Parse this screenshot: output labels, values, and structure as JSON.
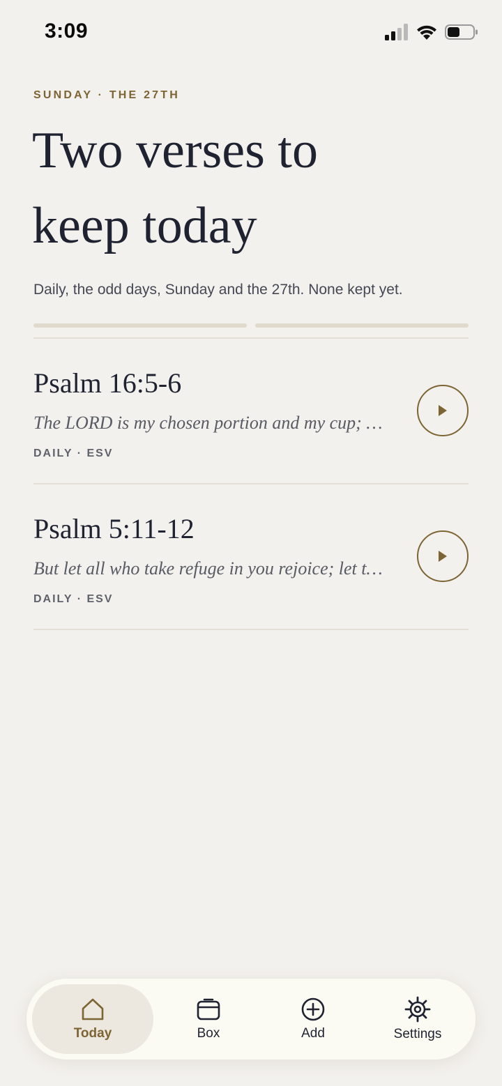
{
  "status_bar": {
    "time": "3:09",
    "icons": [
      "cellular-signal-icon",
      "wifi-icon",
      "battery-icon"
    ]
  },
  "header": {
    "eyebrow": "SUNDAY · THE 27TH",
    "headline_line1": "Two verses to",
    "headline_line2": "keep today",
    "subtitle": "Daily, the odd days, Sunday and the 27th. None kept yet."
  },
  "progress": {
    "segments": 2,
    "kept": 0
  },
  "verses": [
    {
      "reference": "Psalm 16:5-6",
      "excerpt": "The LORD is my chosen portion and my cup; yo...",
      "meta": "DAILY · ESV"
    },
    {
      "reference": "Psalm 5:11-12",
      "excerpt": "But let all who take refuge in you rejoice; let the...",
      "meta": "DAILY · ESV"
    }
  ],
  "tab_bar": {
    "tabs": [
      {
        "label": "Today",
        "icon": "home-icon",
        "active": true
      },
      {
        "label": "Box",
        "icon": "box-icon",
        "active": false
      },
      {
        "label": "Add",
        "icon": "plus-circle-icon",
        "active": false
      },
      {
        "label": "Settings",
        "icon": "gear-icon",
        "active": false
      }
    ]
  },
  "colors": {
    "background": "#f3f1ed",
    "accent": "#7d6433",
    "text": "#1f2230",
    "tab_bar": "#fbfaf3"
  }
}
